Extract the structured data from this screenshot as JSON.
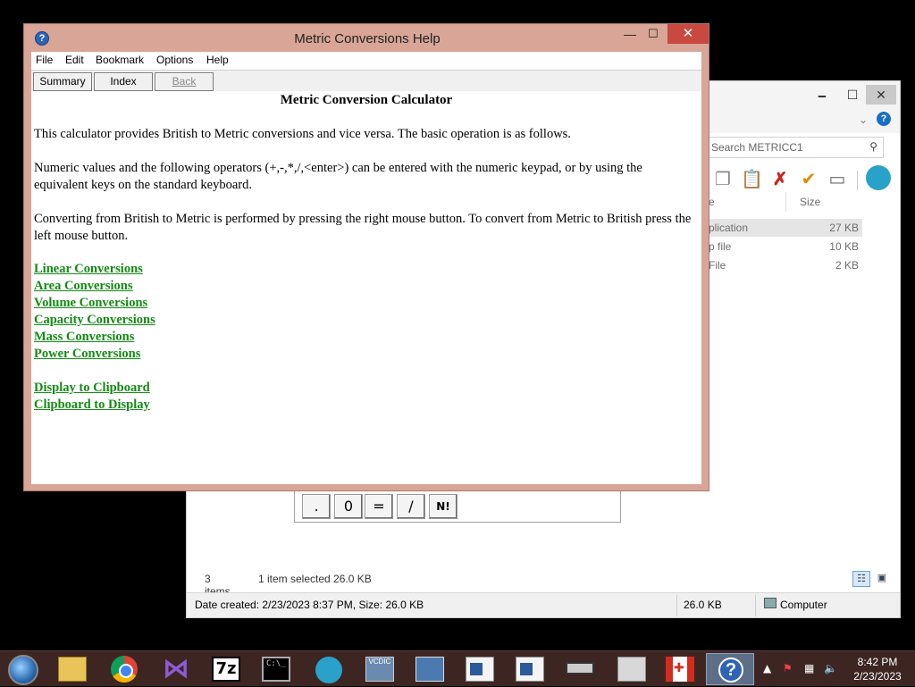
{
  "explorer": {
    "min_glyph": "🗕",
    "max_glyph": "☐",
    "close_glyph": "✕",
    "search_placeholder": "Search METRICC1",
    "columns": {
      "name_partial": "e",
      "size": "Size"
    },
    "files": [
      {
        "name_partial": "plication",
        "size": "27 KB"
      },
      {
        "name_partial": "p file",
        "size": "10 KB"
      },
      {
        "name_partial": "File",
        "size": "2 KB"
      }
    ],
    "status": {
      "items": "3 items",
      "selected": "1 item selected  26.0 KB"
    },
    "details_bar": {
      "details": "Date created: 2/23/2023 8:37 PM, Size: 26.0 KB",
      "size": "26.0 KB",
      "location": "Computer"
    },
    "calc_keys": [
      ".",
      "0",
      "=",
      "/",
      "N!"
    ]
  },
  "help_window": {
    "title": "Metric Conversions Help",
    "icon_glyph": "?",
    "min_glyph": "—",
    "max_glyph": "☐",
    "close_glyph": "✕",
    "menu": [
      "File",
      "Edit",
      "Bookmark",
      "Options",
      "Help"
    ],
    "buttons": [
      "Summary",
      "Index",
      "Back"
    ],
    "content": {
      "title": "Metric Conversion Calculator",
      "paragraphs": [
        "This calculator provides British to Metric conversions and vice versa.  The basic operation is as follows.",
        "Numeric values and the following operators (+,-,*,/,<enter>) can be entered with the numeric keypad, or by using the equivalent keys on the standard keyboard.",
        "Converting from British to Metric is performed by pressing the right mouse button.  To convert from Metric to British press the left mouse button."
      ],
      "links": [
        "Linear Conversions",
        "Area Conversions",
        "Volume Conversions",
        "Capacity Conversions",
        "Mass Conversions",
        "Power Conversions",
        "Display to Clipboard",
        "Clipboard to Display"
      ],
      "link_color": "#138a13"
    }
  },
  "taskbar": {
    "background": "#3d2622",
    "vcdic_label": "VCDIC",
    "sevenz_label": "7z",
    "cmd_label": "C:\\_",
    "helpapp_glyph": "?",
    "time": "8:42 PM",
    "date": "2/23/2023"
  },
  "colors": {
    "help_frame": "#d8a596",
    "close_button": "#c7493f"
  }
}
